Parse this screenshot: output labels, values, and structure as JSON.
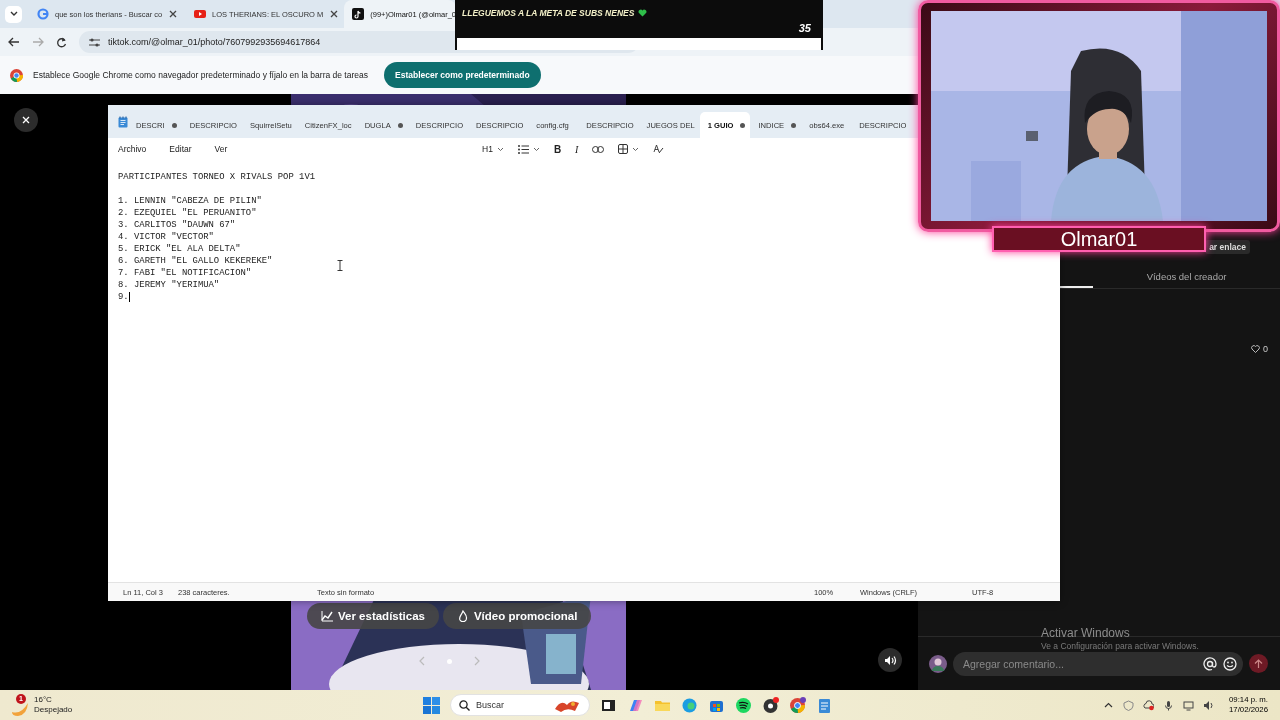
{
  "browser": {
    "tabs": [
      {
        "kind": "search",
        "title": "que son los therians - Buscar co",
        "selected": false
      },
      {
        "kind": "video",
        "title": "LOS THERIANS: EL OSCURO M",
        "selected": false
      },
      {
        "kind": "social",
        "title": "(99+)Olmar01 (@olmar_0",
        "selected": true
      }
    ],
    "url": "tiktok.com/@olmar_01/photo/7607992935694617864",
    "infobar": {
      "message": "Establece Google Chrome como navegador predeterminado y fíjalo en la barra de tareas",
      "button": "Establecer como predeterminado"
    },
    "post": {
      "buttons": [
        {
          "kind": "stats",
          "label": "Ver estadísticas"
        },
        {
          "kind": "promote",
          "label": "Vídeo promocional"
        }
      ]
    },
    "side_panel": {
      "link_button": "ar enlace",
      "tabs": [
        {
          "label": "Vídeos del creador",
          "selected": false
        }
      ],
      "likes": "0",
      "comment_placeholder": "Agregar comentario..."
    }
  },
  "notepad": {
    "tabs": [
      {
        "label": "DESCRI",
        "modified": true,
        "selected": false
      },
      {
        "label": "DESCRIPCIO",
        "modified": false,
        "selected": false
      },
      {
        "label": "SquirrelSetu",
        "modified": false,
        "selected": false
      },
      {
        "label": "CitizenFX_loc",
        "modified": false,
        "selected": false
      },
      {
        "label": "DUGLA",
        "modified": true,
        "selected": false
      },
      {
        "label": "DESCRIPCIO",
        "modified": false,
        "selected": false
      },
      {
        "label": "DESCRIPCIO",
        "modified": false,
        "selected": false
      },
      {
        "label": "config.cfg",
        "modified": false,
        "selected": false
      },
      {
        "label": "DESCRIPCIO",
        "modified": false,
        "selected": false
      },
      {
        "label": "JUEGOS DEL",
        "modified": false,
        "selected": false
      },
      {
        "label": "1 GUIO",
        "modified": true,
        "selected": true
      },
      {
        "label": "INDICE",
        "modified": true,
        "selected": false
      },
      {
        "label": "obs64.exe",
        "modified": false,
        "selected": false
      },
      {
        "label": "DESCRIPCIO",
        "modified": false,
        "selected": false
      }
    ],
    "menu": [
      "Archivo",
      "Editar",
      "Ver"
    ],
    "toolbar": [
      {
        "kind": "heading",
        "label": "H1"
      },
      {
        "kind": "list"
      },
      {
        "kind": "bold",
        "label": "B"
      },
      {
        "kind": "italic",
        "label": "I"
      },
      {
        "kind": "link"
      },
      {
        "kind": "table"
      },
      {
        "kind": "clear"
      }
    ],
    "title": "PARTICIPANTES TORNEO X RIVALS POP 1V1",
    "items": [
      "1. LENNIN \"CABEZA DE PILIN\"",
      "2. EZEQUIEL \"EL PERUANITO\"",
      "3. CARLITOS \"DAUWN 67\"",
      "4. VICTOR \"VECTOR\"",
      "5. ERICK \"EL ALA DELTA\"",
      "6. GARETH \"EL GALLO KEKEREKE\"",
      "7. FABI \"EL NOTIFICACION\"",
      "8. JEREMY \"YERIMUA\"",
      "9."
    ],
    "status": [
      "Ln 11, Col 3",
      "238 caracteres.",
      "Texto sin formato",
      "100%",
      "Windows (CRLF)",
      "UTF-8"
    ]
  },
  "banner": {
    "message": "LLEGUEMOS A LA META DE SUBS NENES",
    "count": "35"
  },
  "webcam": {
    "name": "Olmar01"
  },
  "activation": {
    "title": "Activar Windows",
    "subtitle": "Ve a Configuración para activar Windows."
  },
  "taskbar": {
    "weather": {
      "badge": "1",
      "temperature": "16°C",
      "condition": "Despejado"
    },
    "search": "Buscar",
    "time": "09:14 p. m.",
    "date": "17/02/2026"
  }
}
